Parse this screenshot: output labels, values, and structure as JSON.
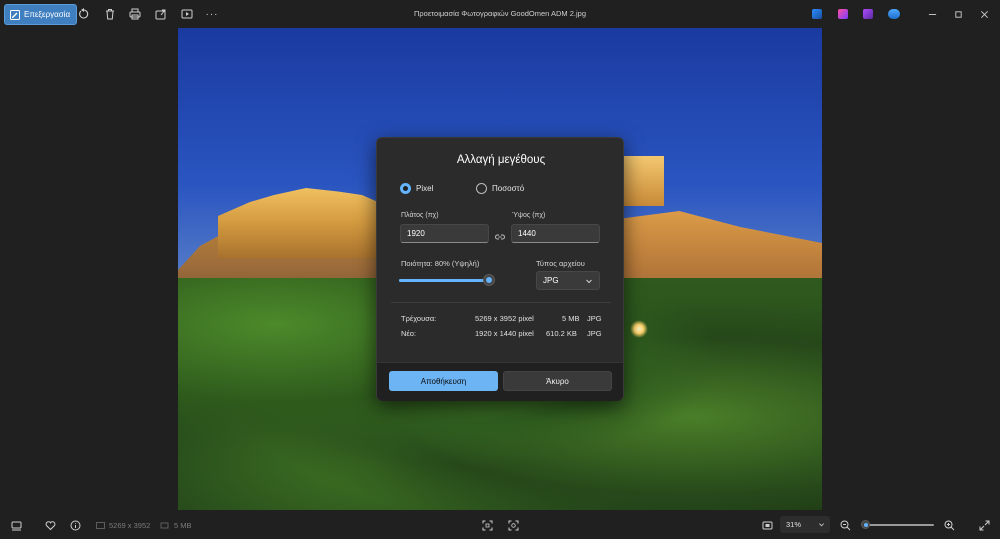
{
  "toolbar": {
    "edit_label": "Επεξεργασία",
    "title": "Προετοιμασία Φωτογραφιών GoodOmen ADM 2.jpg",
    "more_label": "···"
  },
  "dialog": {
    "title": "Αλλαγή μεγέθους",
    "mode_pixel": "Pixel",
    "mode_percent": "Ποσοστό",
    "selected_mode": "Pixel",
    "width_label": "Πλάτος (πχ)",
    "height_label": "Ύψος (πχ)",
    "width_value": "1920",
    "height_value": "1440",
    "quality_label": "Ποιότητα: 80% (Υψηλή)",
    "quality_value": 80,
    "filetype_label": "Τύπος αρχείου",
    "filetype_value": "JPG",
    "current_label": "Τρέχουσα:",
    "current_dims": "5269 x 3952 pixel",
    "current_size": "5 MB",
    "current_type": "JPG",
    "new_label": "Νέο:",
    "new_dims": "1920 x 1440 pixel",
    "new_size": "610.2 KB",
    "new_type": "JPG",
    "save_label": "Αποθήκευση",
    "cancel_label": "Άκυρο"
  },
  "statusbar": {
    "dimensions": "5269 x 3952",
    "filesize": "5 MB",
    "zoom": "31%",
    "zoom_level": 0.06
  },
  "colors": {
    "accent": "#63b3ff",
    "primary_button": "#6cb4f4",
    "background": "#202020",
    "dialog": "#2b2b2b"
  }
}
